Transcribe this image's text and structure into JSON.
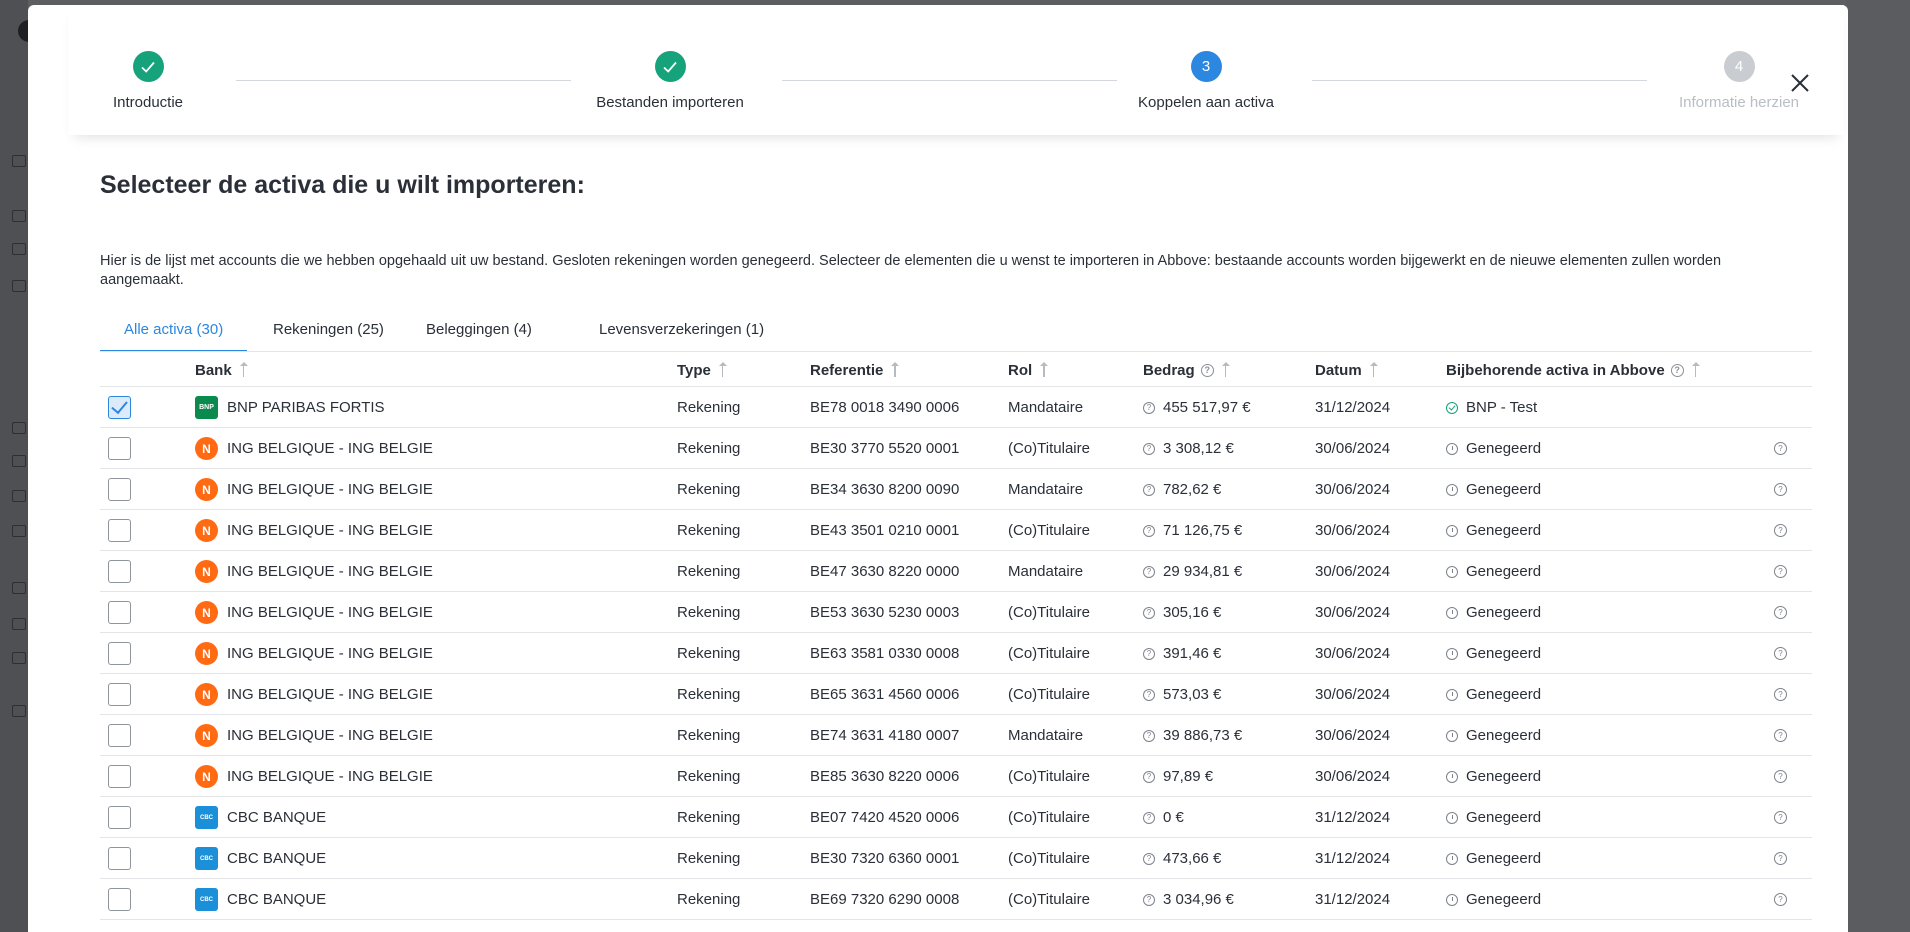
{
  "stepper": {
    "steps": [
      {
        "number": "1",
        "label": "Introductie",
        "status": "done"
      },
      {
        "number": "2",
        "label": "Bestanden importeren",
        "status": "done"
      },
      {
        "number": "3",
        "label": "Koppelen aan activa",
        "status": "active"
      },
      {
        "number": "4",
        "label": "Informatie herzien",
        "status": "pending"
      }
    ]
  },
  "heading": "Selecteer de activa die u wilt importeren:",
  "description": "Hier is de lijst met accounts die we hebben opgehaald uit uw bestand. Gesloten rekeningen worden genegeerd. Selecteer de elementen die u wenst te importeren in Abbove: bestaande accounts worden bijgewerkt en de nieuwe elementen zullen worden aangemaakt.",
  "tabs": [
    {
      "label": "Alle activa (30)",
      "active": true
    },
    {
      "label": "Rekeningen (25)",
      "active": false
    },
    {
      "label": "Beleggingen (4)",
      "active": false
    },
    {
      "label": "Levensverzekeringen (1)",
      "active": false
    }
  ],
  "table": {
    "headers": {
      "bank": "Bank",
      "type": "Type",
      "referentie": "Referentie",
      "rol": "Rol",
      "bedrag": "Bedrag",
      "datum": "Datum",
      "bijbehorende": "Bijbehorende activa in Abbove"
    },
    "rows": [
      {
        "checked": true,
        "logo": "bnp",
        "logo_text": "BNP",
        "bank": "BNP PARIBAS FORTIS",
        "type": "Rekening",
        "ref": "BE78 0018 3490 0006",
        "rol": "Mandataire",
        "bedrag": "455 517,97 €",
        "datum": "31/12/2024",
        "status": "ok",
        "activa": "BNP - Test",
        "help": false
      },
      {
        "checked": false,
        "logo": "ing",
        "logo_text": "N",
        "bank": "ING BELGIQUE - ING BELGIE",
        "type": "Rekening",
        "ref": "BE30 3770 5520 0001",
        "rol": "(Co)Titulaire",
        "bedrag": "3 308,12 €",
        "datum": "30/06/2024",
        "status": "ign",
        "activa": "Genegeerd",
        "help": true
      },
      {
        "checked": false,
        "logo": "ing",
        "logo_text": "N",
        "bank": "ING BELGIQUE - ING BELGIE",
        "type": "Rekening",
        "ref": "BE34 3630 8200 0090",
        "rol": "Mandataire",
        "bedrag": "782,62 €",
        "datum": "30/06/2024",
        "status": "ign",
        "activa": "Genegeerd",
        "help": true
      },
      {
        "checked": false,
        "logo": "ing",
        "logo_text": "N",
        "bank": "ING BELGIQUE - ING BELGIE",
        "type": "Rekening",
        "ref": "BE43 3501 0210 0001",
        "rol": "(Co)Titulaire",
        "bedrag": "71 126,75 €",
        "datum": "30/06/2024",
        "status": "ign",
        "activa": "Genegeerd",
        "help": true
      },
      {
        "checked": false,
        "logo": "ing",
        "logo_text": "N",
        "bank": "ING BELGIQUE - ING BELGIE",
        "type": "Rekening",
        "ref": "BE47 3630 8220 0000",
        "rol": "Mandataire",
        "bedrag": "29 934,81 €",
        "datum": "30/06/2024",
        "status": "ign",
        "activa": "Genegeerd",
        "help": true
      },
      {
        "checked": false,
        "logo": "ing",
        "logo_text": "N",
        "bank": "ING BELGIQUE - ING BELGIE",
        "type": "Rekening",
        "ref": "BE53 3630 5230 0003",
        "rol": "(Co)Titulaire",
        "bedrag": "305,16 €",
        "datum": "30/06/2024",
        "status": "ign",
        "activa": "Genegeerd",
        "help": true
      },
      {
        "checked": false,
        "logo": "ing",
        "logo_text": "N",
        "bank": "ING BELGIQUE - ING BELGIE",
        "type": "Rekening",
        "ref": "BE63 3581 0330 0008",
        "rol": "(Co)Titulaire",
        "bedrag": "391,46 €",
        "datum": "30/06/2024",
        "status": "ign",
        "activa": "Genegeerd",
        "help": true
      },
      {
        "checked": false,
        "logo": "ing",
        "logo_text": "N",
        "bank": "ING BELGIQUE - ING BELGIE",
        "type": "Rekening",
        "ref": "BE65 3631 4560 0006",
        "rol": "(Co)Titulaire",
        "bedrag": "573,03 €",
        "datum": "30/06/2024",
        "status": "ign",
        "activa": "Genegeerd",
        "help": true
      },
      {
        "checked": false,
        "logo": "ing",
        "logo_text": "N",
        "bank": "ING BELGIQUE - ING BELGIE",
        "type": "Rekening",
        "ref": "BE74 3631 4180 0007",
        "rol": "Mandataire",
        "bedrag": "39 886,73 €",
        "datum": "30/06/2024",
        "status": "ign",
        "activa": "Genegeerd",
        "help": true
      },
      {
        "checked": false,
        "logo": "ing",
        "logo_text": "N",
        "bank": "ING BELGIQUE - ING BELGIE",
        "type": "Rekening",
        "ref": "BE85 3630 8220 0006",
        "rol": "(Co)Titulaire",
        "bedrag": "97,89 €",
        "datum": "30/06/2024",
        "status": "ign",
        "activa": "Genegeerd",
        "help": true
      },
      {
        "checked": false,
        "logo": "cbc",
        "logo_text": "CBC",
        "bank": "CBC BANQUE",
        "type": "Rekening",
        "ref": "BE07 7420 4520 0006",
        "rol": "(Co)Titulaire",
        "bedrag": "0 €",
        "datum": "31/12/2024",
        "status": "ign",
        "activa": "Genegeerd",
        "help": true
      },
      {
        "checked": false,
        "logo": "cbc",
        "logo_text": "CBC",
        "bank": "CBC BANQUE",
        "type": "Rekening",
        "ref": "BE30 7320 6360 0001",
        "rol": "(Co)Titulaire",
        "bedrag": "473,66 €",
        "datum": "31/12/2024",
        "status": "ign",
        "activa": "Genegeerd",
        "help": true
      },
      {
        "checked": false,
        "logo": "cbc",
        "logo_text": "CBC",
        "bank": "CBC BANQUE",
        "type": "Rekening",
        "ref": "BE69 7320 6290 0008",
        "rol": "(Co)Titulaire",
        "bedrag": "3 034,96 €",
        "datum": "31/12/2024",
        "status": "ign",
        "activa": "Genegeerd",
        "help": true
      }
    ]
  },
  "colors": {
    "accent": "#2c87e0",
    "done": "#16a37b",
    "pending": "#c9ccd1"
  }
}
